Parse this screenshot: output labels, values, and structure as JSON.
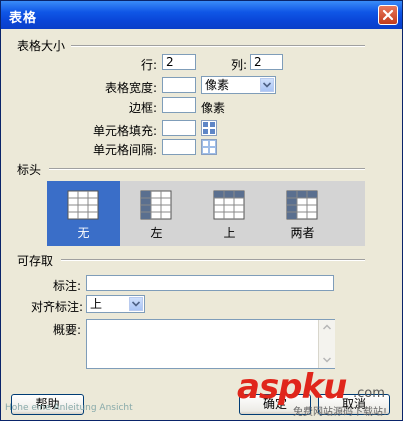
{
  "window": {
    "title": "表格"
  },
  "size_section": {
    "heading": "表格大小",
    "rows_label": "行:",
    "rows_value": "2",
    "cols_label": "列:",
    "cols_value": "2",
    "width_label": "表格宽度:",
    "width_value": "",
    "width_unit": "像素",
    "border_label": "边框:",
    "border_value": "",
    "border_unit": "像素",
    "padding_label": "单元格填充:",
    "padding_value": "",
    "spacing_label": "单元格间隔:",
    "spacing_value": ""
  },
  "header_section": {
    "heading": "标头",
    "options": [
      {
        "label": "无",
        "icon": "table-no-header-icon",
        "selected": true
      },
      {
        "label": "左",
        "icon": "table-left-header-icon",
        "selected": false
      },
      {
        "label": "上",
        "icon": "table-top-header-icon",
        "selected": false
      },
      {
        "label": "两者",
        "icon": "table-both-header-icon",
        "selected": false
      }
    ]
  },
  "access_section": {
    "heading": "可存取",
    "caption_label": "标注:",
    "caption_value": "",
    "align_label": "对齐标注:",
    "align_value": "上",
    "summary_label": "概要:",
    "summary_value": ""
  },
  "buttons": {
    "help": "帮助",
    "ok": "确定",
    "cancel": "取消"
  },
  "watermark": {
    "brand": "aspku",
    "suffix": ".com",
    "tagline": "免费网站源码下载站!",
    "left_text": "Hohe eine Anleitung Ansicht"
  },
  "colors": {
    "title_bar": "#0a46d8",
    "dialog_bg": "#ece9d8",
    "selected_header": "#3a6ec8",
    "watermark": "#e0261b"
  }
}
